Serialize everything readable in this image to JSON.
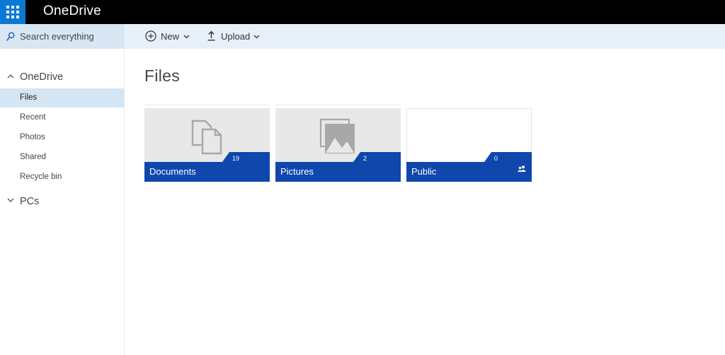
{
  "topbar": {
    "app_title": "OneDrive"
  },
  "search": {
    "placeholder": "Search everything"
  },
  "commands": {
    "new_label": "New",
    "upload_label": "Upload"
  },
  "nav": {
    "section_onedrive": "OneDrive",
    "items": [
      "Files",
      "Recent",
      "Photos",
      "Shared",
      "Recycle bin"
    ],
    "active_item": "Files",
    "section_pcs": "PCs"
  },
  "main": {
    "title": "Files",
    "folders": [
      {
        "name": "Documents",
        "count": "19",
        "icon": "documents-icon"
      },
      {
        "name": "Pictures",
        "count": "2",
        "icon": "pictures-icon"
      },
      {
        "name": "Public",
        "count": "0",
        "icon": "shared-people-icon"
      }
    ]
  },
  "colors": {
    "topbar": "#000000",
    "waffle": "#0a79d4",
    "command_bar": "#e7f0f8",
    "search_box": "#d9e7f4",
    "nav_active": "#d4e5f3",
    "tile_band": "#0f47ac",
    "tile_thumb": "#e8e8e8"
  }
}
